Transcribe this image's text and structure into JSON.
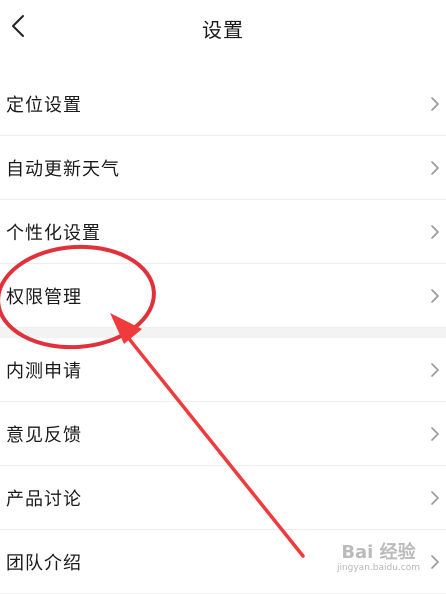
{
  "header": {
    "title": "设置",
    "back_icon": "chevron-left-icon"
  },
  "groups": [
    {
      "items": [
        {
          "label": "定位设置"
        },
        {
          "label": "自动更新天气"
        },
        {
          "label": "个性化设置"
        },
        {
          "label": "权限管理"
        }
      ]
    },
    {
      "items": [
        {
          "label": "内测申请"
        },
        {
          "label": "意见反馈"
        },
        {
          "label": "产品讨论"
        },
        {
          "label": "团队介绍"
        }
      ]
    }
  ],
  "annotation": {
    "circle_color": "#e0323a",
    "arrow_color": "#ef3b3b"
  },
  "watermark": {
    "main": "Bai 经验",
    "sub": "jingyan.baidu.com"
  }
}
